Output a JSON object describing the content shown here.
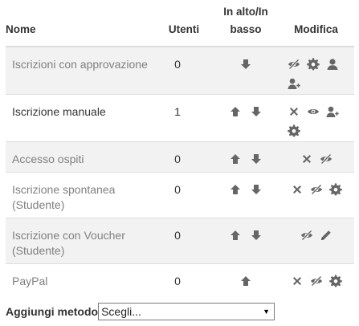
{
  "headers": {
    "name": "Nome",
    "users": "Utenti",
    "updown": "In alto/In basso",
    "edit": "Modifica"
  },
  "rows": [
    {
      "name": "Iscrizioni con approvazione",
      "users": "0",
      "disabled": true
    },
    {
      "name": "Iscrizione manuale",
      "users": "1",
      "disabled": false
    },
    {
      "name": "Accesso ospiti",
      "users": "0",
      "disabled": true
    },
    {
      "name": "Iscrizione spontanea (Studente)",
      "users": "0",
      "disabled": true
    },
    {
      "name": "Iscrizione con Voucher (Studente)",
      "users": "0",
      "disabled": true
    },
    {
      "name": "PayPal",
      "users": "0",
      "disabled": true
    }
  ],
  "add_method": {
    "label": "Aggiungi metodo",
    "selected": "Scegli..."
  },
  "colors": {
    "icon": "#666666",
    "stripe": "#f2f2f2",
    "border": "#dddddd"
  }
}
